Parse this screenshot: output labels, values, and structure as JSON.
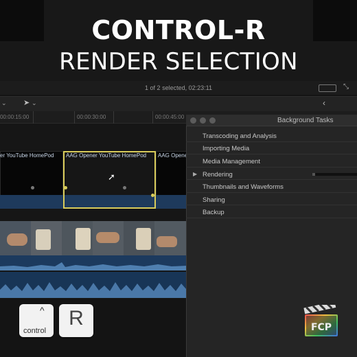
{
  "overlay": {
    "title": "CONTROL-R",
    "subtitle": "RENDER SELECTION"
  },
  "viewer": {
    "status": "1 of 2 selected, 02:23:11"
  },
  "toolbar": {
    "tool_arrow_icon": "select-arrow-icon",
    "back_chevron_icon": "chevron-left-icon"
  },
  "ruler": {
    "ticks": [
      "00:00:15:00",
      "00:00:30:00",
      "00:00:45:00"
    ]
  },
  "timeline": {
    "clips": [
      {
        "label": "er YouTube HomePod"
      },
      {
        "label": "AAG Opener YouTube HomePod"
      },
      {
        "label": "AAG Opene"
      }
    ]
  },
  "background_tasks": {
    "title": "Background Tasks",
    "rows": [
      {
        "label": "Transcoding and Analysis"
      },
      {
        "label": "Importing Media"
      },
      {
        "label": "Media Management"
      },
      {
        "label": "Rendering"
      },
      {
        "label": "Thumbnails and Waveforms"
      },
      {
        "label": "Sharing"
      },
      {
        "label": "Backup"
      }
    ]
  },
  "keys": {
    "modifier_symbol": "^",
    "modifier_label": "control",
    "letter": "R"
  },
  "logo": {
    "text": "FCP"
  },
  "colors": {
    "selection": "#d9cc5a",
    "clip_blue": "#1e3a5c"
  }
}
